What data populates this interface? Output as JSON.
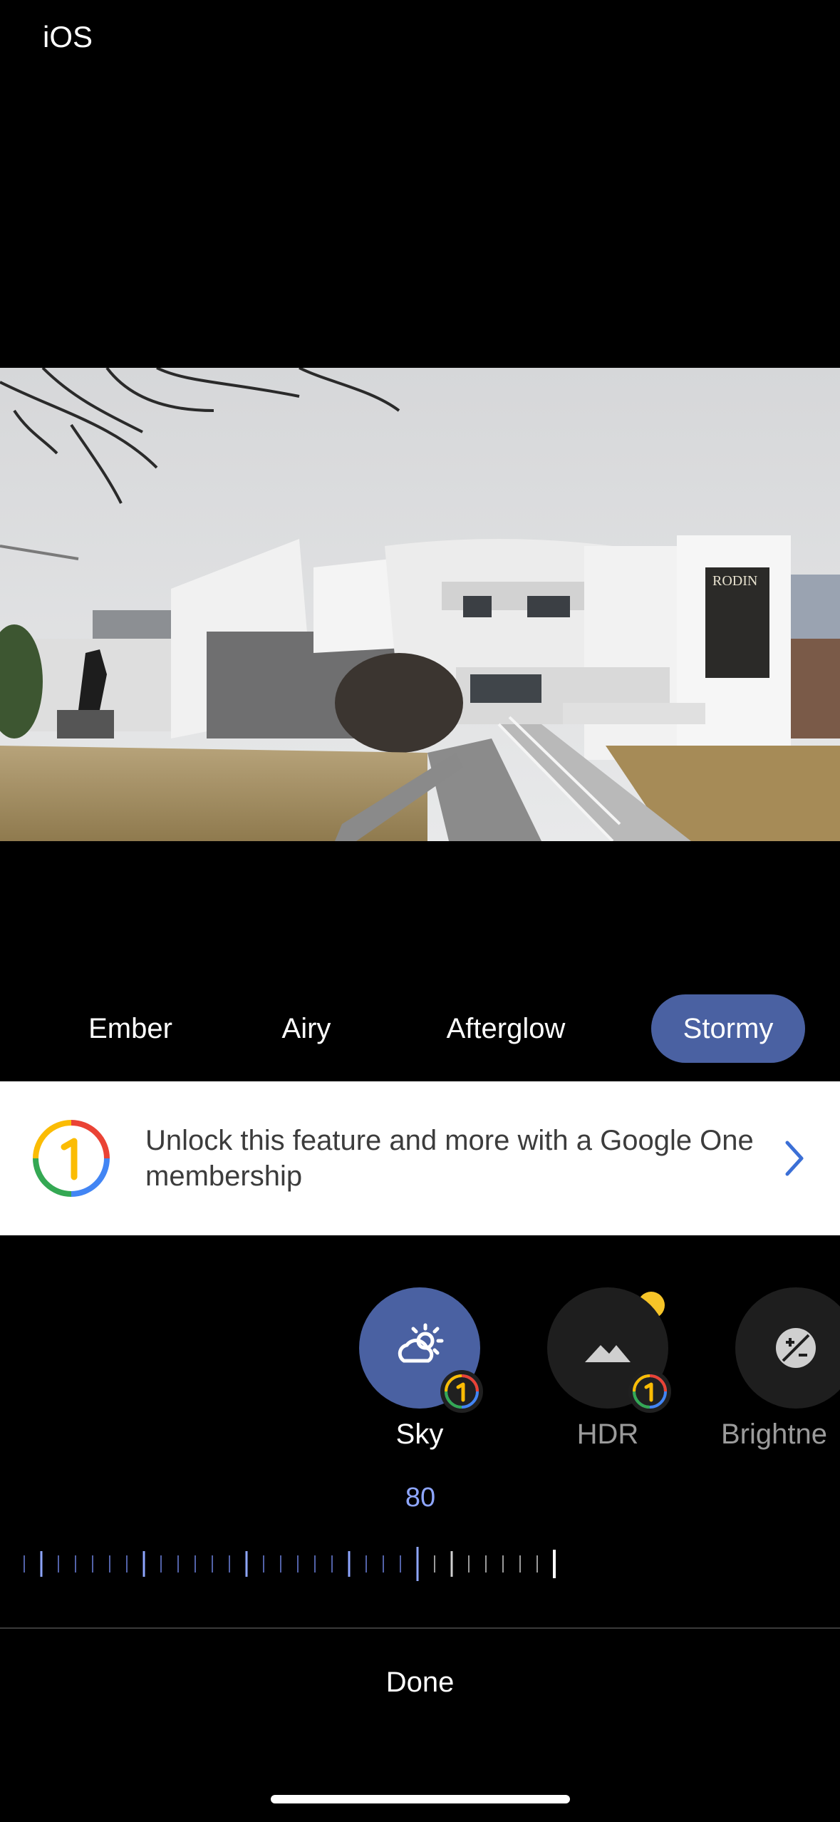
{
  "status": {
    "label": "iOS"
  },
  "photo": {
    "poster_text": "RODIN"
  },
  "styles": {
    "items": [
      {
        "label": "Ember",
        "selected": false
      },
      {
        "label": "Airy",
        "selected": false
      },
      {
        "label": "Afterglow",
        "selected": false
      },
      {
        "label": "Stormy",
        "selected": true
      }
    ]
  },
  "banner": {
    "text": "Unlock this feature and more with a Google One membership",
    "logo_digit": "1"
  },
  "tools": {
    "items": [
      {
        "label": "Sky",
        "icon": "sky-icon",
        "active": true,
        "premium": true
      },
      {
        "label": "HDR",
        "icon": "mountain-icon",
        "active": false,
        "premium": true
      },
      {
        "label": "Brightne",
        "icon": "brightness-icon",
        "active": false,
        "premium": false
      }
    ]
  },
  "slider": {
    "value": "80"
  },
  "footer": {
    "done_label": "Done"
  },
  "colors": {
    "accent": "#4a61a2",
    "slider_blue": "#8ea6ff",
    "new_dot": "#f6c428"
  }
}
